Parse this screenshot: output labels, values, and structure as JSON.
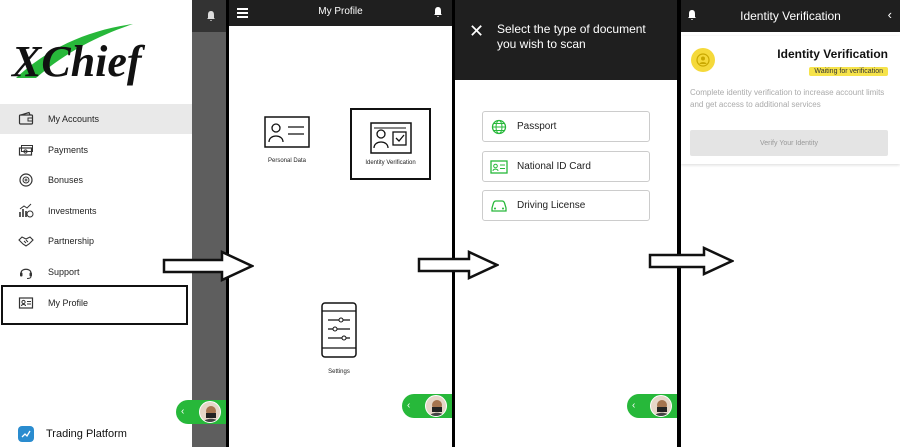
{
  "sidebar": {
    "logo_text": "XChief",
    "items": [
      {
        "label": "My Accounts",
        "icon": "wallet-icon"
      },
      {
        "label": "Payments",
        "icon": "money-icon"
      },
      {
        "label": "Bonuses",
        "icon": "bonus-icon"
      },
      {
        "label": "Investments",
        "icon": "investment-icon"
      },
      {
        "label": "Partnership",
        "icon": "handshake-icon"
      },
      {
        "label": "Support",
        "icon": "headset-icon"
      },
      {
        "label": "My Profile",
        "icon": "id-card-icon"
      }
    ],
    "trading_platform": "Trading Platform"
  },
  "profile": {
    "title": "My Profile",
    "tiles": [
      {
        "label": "Personal Data",
        "icon": "id-card-icon"
      },
      {
        "label": "Identity Verification",
        "icon": "verify-id-icon"
      },
      {
        "label": "Settings",
        "icon": "phone-settings-icon"
      }
    ]
  },
  "scan": {
    "title": "Select the type of document you wish to scan",
    "options": [
      {
        "label": "Passport",
        "icon": "globe-icon"
      },
      {
        "label": "National ID Card",
        "icon": "id-card-icon"
      },
      {
        "label": "Driving License",
        "icon": "car-icon"
      }
    ]
  },
  "verification": {
    "header": "Identity Verification",
    "card_title": "Identity Verification",
    "status": "Waiting for verification",
    "description": "Complete identity verification to increase account limits and get access to additional services",
    "button": "Verify Your Identity"
  },
  "colors": {
    "brand_green": "#27b83a",
    "status_yellow": "#f6e34a",
    "header_dark": "#1f1f1f"
  }
}
